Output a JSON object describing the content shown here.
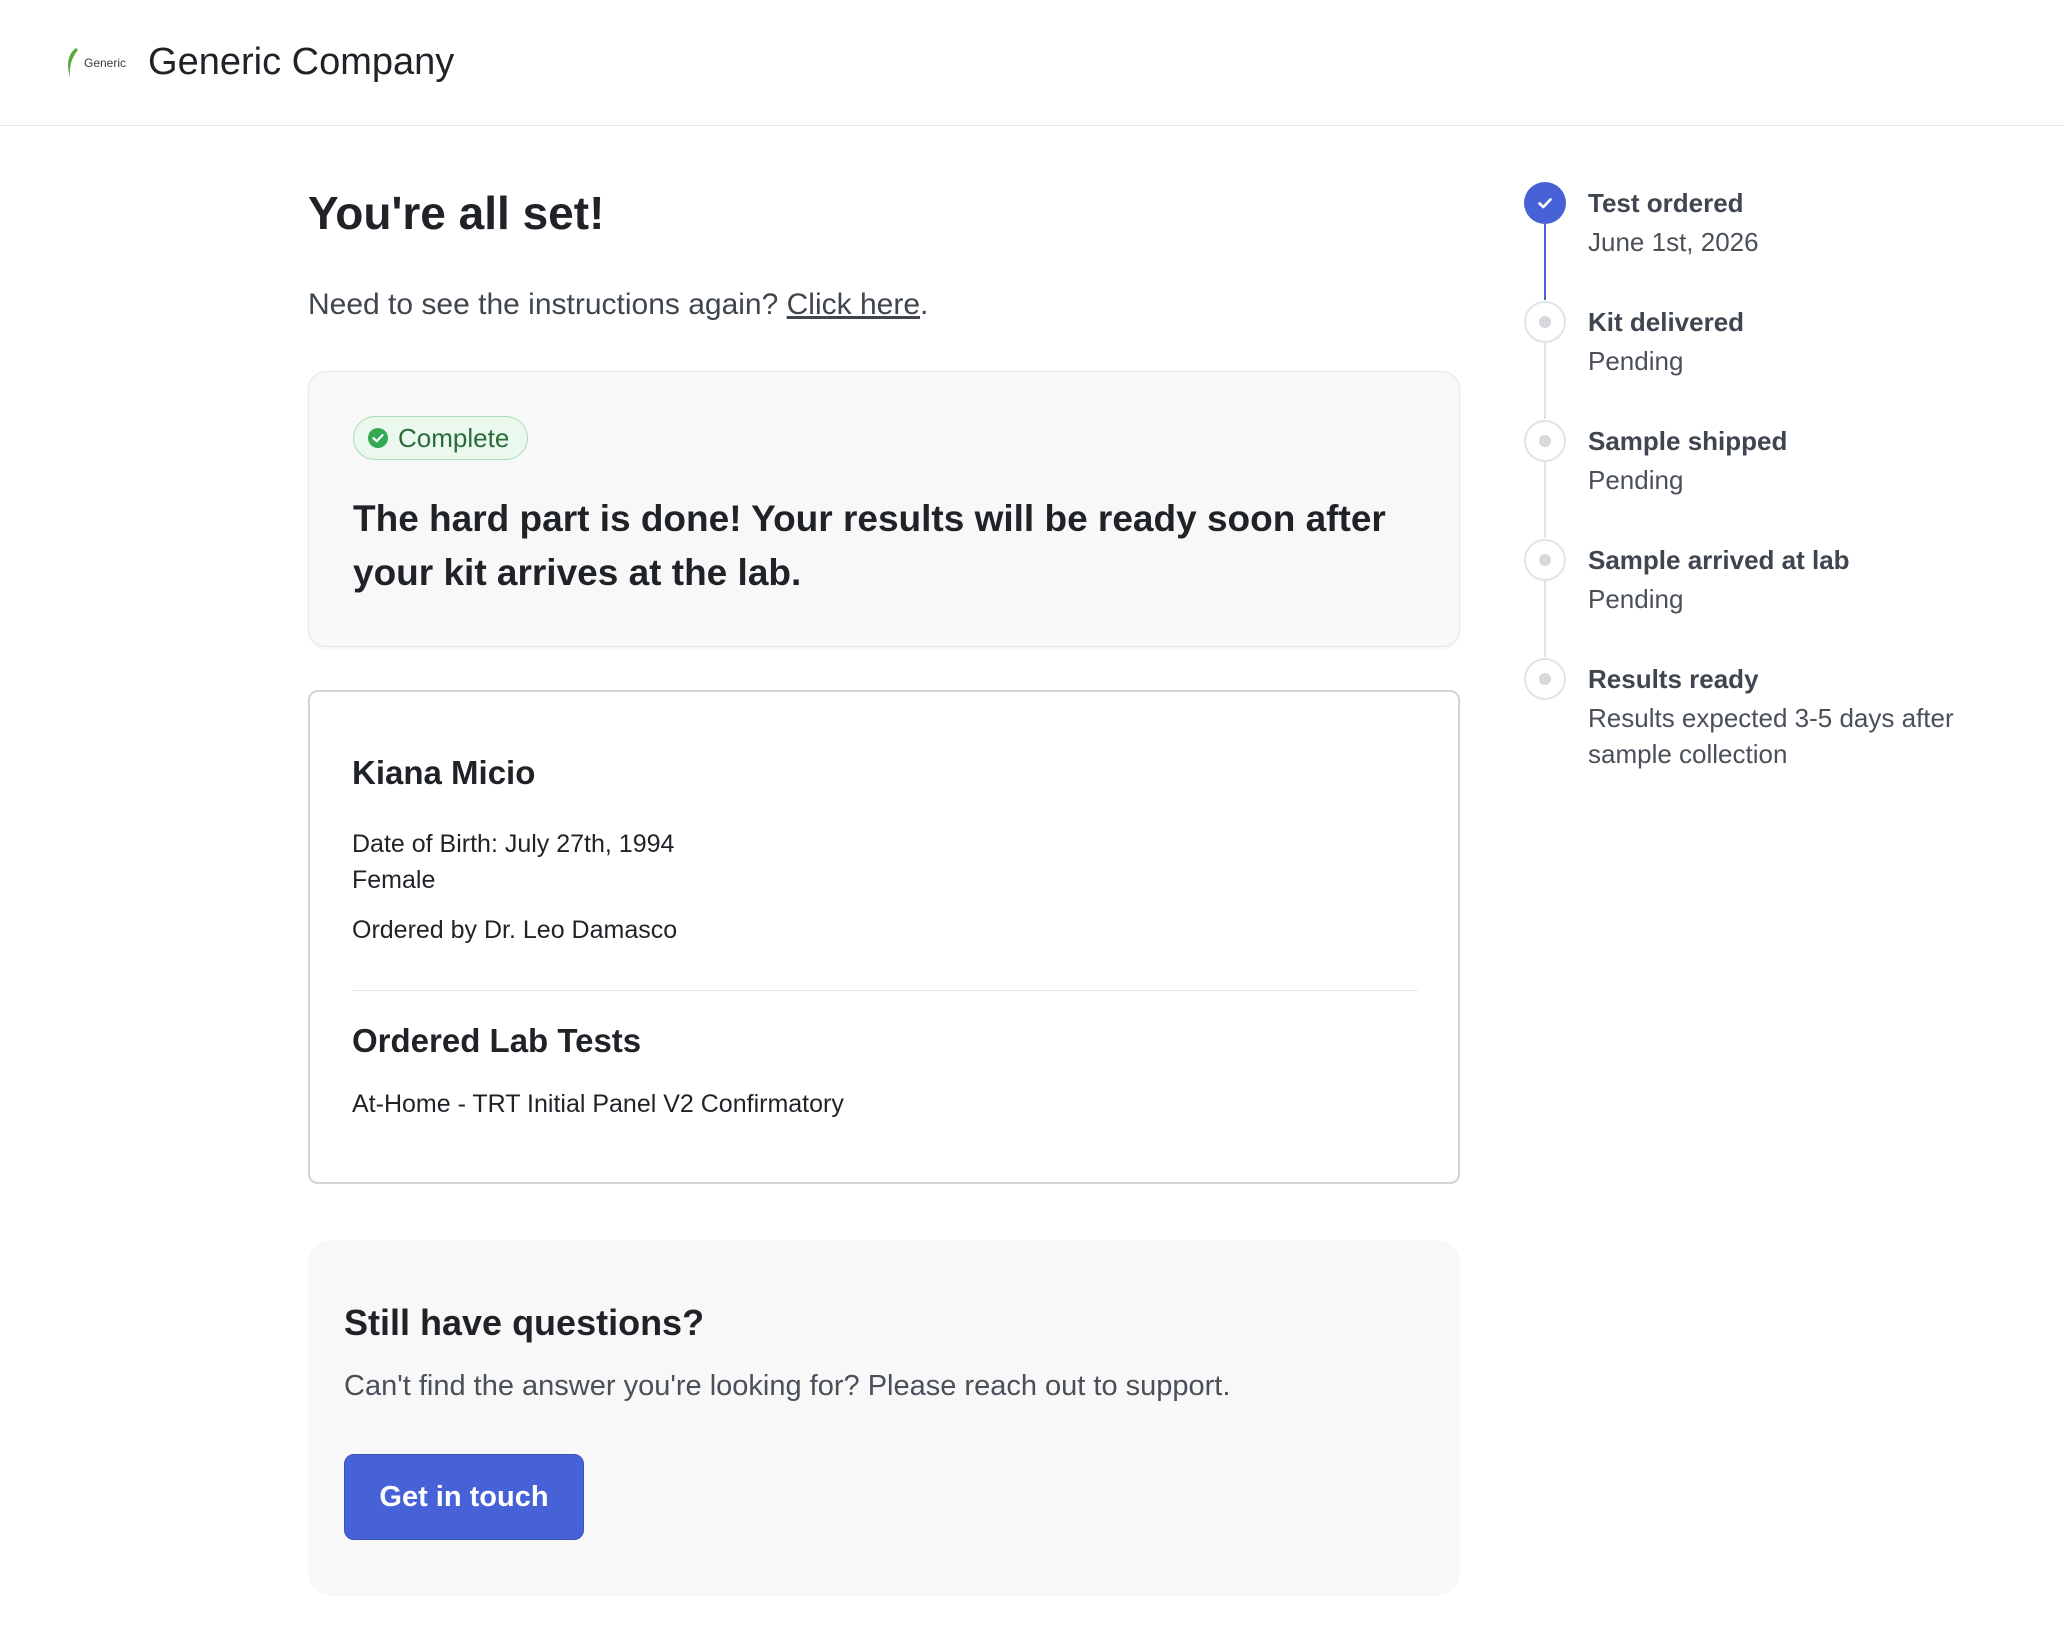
{
  "header": {
    "logo_text": "Generic",
    "company_name": "Generic Company"
  },
  "main": {
    "title": "You're all set!",
    "instructions_prefix": "Need to see the instructions again? ",
    "instructions_link": "Click here",
    "instructions_suffix": ".",
    "status_card": {
      "badge": "Complete",
      "message": "The hard part is done! Your results will be ready soon after your kit arrives at the lab."
    },
    "patient_card": {
      "name": "Kiana Micio",
      "dob": "Date of Birth: July 27th, 1994",
      "sex": "Female",
      "ordered_by": "Ordered by Dr. Leo Damasco",
      "tests_heading": "Ordered Lab Tests",
      "tests": [
        "At-Home - TRT Initial Panel V2 Confirmatory"
      ]
    },
    "help_card": {
      "title": "Still have questions?",
      "text": "Can't find the answer you're looking for? Please reach out to support.",
      "button": "Get in touch"
    }
  },
  "timeline": {
    "accent_color": "#4761d6",
    "steps": [
      {
        "label": "Test ordered",
        "status": "June 1st, 2026",
        "state": "done"
      },
      {
        "label": "Kit delivered",
        "status": "Pending",
        "state": "pending"
      },
      {
        "label": "Sample shipped",
        "status": "Pending",
        "state": "pending"
      },
      {
        "label": "Sample arrived at lab",
        "status": "Pending",
        "state": "pending"
      },
      {
        "label": "Results ready",
        "status": "Results expected 3-5 days after sample collection",
        "state": "pending"
      }
    ]
  }
}
